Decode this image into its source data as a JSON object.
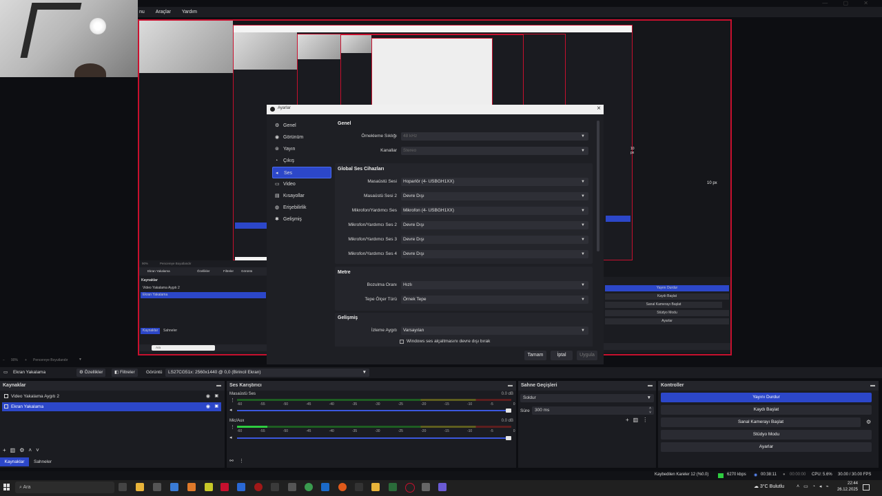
{
  "menubar": {
    "items": [
      "nu",
      "Araçlar",
      "Yardım"
    ]
  },
  "preview_nested": {
    "menu_items": [
      "nu",
      "Araçlar",
      "Yardım"
    ],
    "labels": {
      "px_right": "10 px",
      "px_right2": "10 px",
      "zoom": "90%",
      "fit": "Pencereye Boyutlandır"
    },
    "sources": [
      "Ekran Yakalama",
      "Video Yakalama Aygıtı 2",
      "Ekran Yakalama"
    ],
    "tabs": [
      "Kaynaklar",
      "Sahneler"
    ],
    "buttons": [
      "Özellikler",
      "Filtreler",
      "Görüntü"
    ],
    "controls": [
      "Yayını Durdur",
      "Kaydı Başlat",
      "Sanal Kamerayı Başlat",
      "Stüdyo Modu",
      "Ayarlar"
    ],
    "search": "Ara"
  },
  "dialog": {
    "title": "Ayarlar",
    "nav": [
      {
        "label": "Genel",
        "icon": "gear-icon"
      },
      {
        "label": "Görünüm",
        "icon": "palette-icon"
      },
      {
        "label": "Yayın",
        "icon": "broadcast-icon"
      },
      {
        "label": "Çıkış",
        "icon": "output-icon"
      },
      {
        "label": "Ses",
        "icon": "speaker-icon",
        "active": true
      },
      {
        "label": "Video",
        "icon": "monitor-icon"
      },
      {
        "label": "Kısayollar",
        "icon": "keyboard-icon"
      },
      {
        "label": "Erişebilirlik",
        "icon": "accessibility-icon"
      },
      {
        "label": "Gelişmiş",
        "icon": "wrench-icon"
      }
    ],
    "sections": {
      "general": {
        "title": "Genel",
        "rows": [
          {
            "label": "Örnekleme Sıklığı",
            "value": "48 kHz",
            "disabled": true
          },
          {
            "label": "Kanallar",
            "value": "Stereo",
            "disabled": true
          }
        ]
      },
      "global": {
        "title": "Global Ses Cihazları",
        "rows": [
          {
            "label": "Masaüstü Sesi",
            "value": "Hoparlör (4- USBGH1XX)"
          },
          {
            "label": "Masaüstü Sesi 2",
            "value": "Devre Dışı"
          },
          {
            "label": "Mikrofon/Yardımcı Ses",
            "value": "Mikrofon (4- USBGH1XX)"
          },
          {
            "label": "Mikrofon/Yardımcı Ses 2",
            "value": "Devre Dışı"
          },
          {
            "label": "Mikrofon/Yardımcı Ses 3",
            "value": "Devre Dışı"
          },
          {
            "label": "Mikrofon/Yardımcı Ses 4",
            "value": "Devre Dışı"
          }
        ]
      },
      "meters": {
        "title": "Metre",
        "rows": [
          {
            "label": "Bozulma Oranı",
            "value": "Hızlı"
          },
          {
            "label": "Tepe Ölçer Türü",
            "value": "Örnek Tepe"
          }
        ]
      },
      "advanced": {
        "title": "Gelişmiş",
        "rows": [
          {
            "label": "İzleme Aygıtı",
            "value": "Varsayılan"
          }
        ],
        "checkbox": "Windows ses alçaltmasını devre dışı bırak"
      }
    },
    "buttons": {
      "ok": "Tamam",
      "cancel": "İptal",
      "apply": "Uygula"
    }
  },
  "zoombar": {
    "zoom": "90%",
    "fit": "Pencereye Boyutlandır"
  },
  "toolbar": {
    "source_name": "Ekran Yakalama",
    "properties": "Özellikler",
    "filters": "Filtreler",
    "display_label": "Görüntü",
    "display_value": "LS27CG51x: 2560x1440 @ 0,0 (Birincil Ekran)"
  },
  "sources_dock": {
    "title": "Kaynaklar",
    "items": [
      {
        "label": "Video Yakalama Aygıtı 2",
        "selected": false
      },
      {
        "label": "Ekran Yakalama",
        "selected": true
      }
    ],
    "tabs": [
      "Kaynaklar",
      "Sahneler"
    ]
  },
  "mixer_dock": {
    "title": "Ses Karıştırıcı",
    "channels": [
      {
        "name": "Masaüstü Ses",
        "db": "0.0 dB",
        "level": 0.0
      },
      {
        "name": "Mic/Aux",
        "db": "0.0 dB",
        "level": 0.11
      }
    ],
    "ticks": [
      "-60",
      "-55",
      "-50",
      "-45",
      "-40",
      "-35",
      "-30",
      "-25",
      "-20",
      "-15",
      "-10",
      "-5",
      "0"
    ]
  },
  "transitions_dock": {
    "title": "Sahne Geçişleri",
    "transition": "Soldur",
    "duration_label": "Süre",
    "duration_value": "300 ms"
  },
  "controls_dock": {
    "title": "Kontroller",
    "buttons": [
      "Yayını Durdur",
      "Kaydı Başlat",
      "Sanal Kamerayı Başlat",
      "Stüdyo Modu",
      "Ayarlar"
    ]
  },
  "status": {
    "dropped": "Kaybedilen Kareler 12 (%0.0)",
    "bitrate": "6270 kbps",
    "stream_time": "00:38:11",
    "rec_time": "00:00:00",
    "cpu": "CPU: 5.6%",
    "fps": "30.00 / 30.00 FPS"
  },
  "taskbar": {
    "search": "Ara",
    "weather": "3°C Bulutlu",
    "time": "22:44",
    "date": "26.12.2025"
  },
  "colors": {
    "accent": "#2c47c9",
    "record_border": "#c8102e",
    "meter_green": "#2ecc40",
    "meter_yellow": "#c9c928",
    "meter_red": "#d42020"
  }
}
